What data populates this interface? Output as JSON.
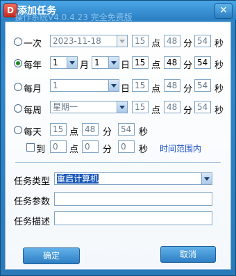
{
  "window": {
    "title": "添加任务",
    "watermark": "操作系统V4.0.4.23 完全免费版",
    "icon_letter": "D"
  },
  "units": {
    "hour": "点",
    "minute": "分",
    "second": "秒",
    "month": "月",
    "day": "日"
  },
  "once": {
    "label": "一次",
    "date": "2023-11-18",
    "hour": "15",
    "minute": "48",
    "second": "54"
  },
  "yearly": {
    "label": "每年",
    "month": "1",
    "day": "1",
    "hour": "15",
    "minute": "48",
    "second": "54"
  },
  "monthly": {
    "label": "每月",
    "day": "1",
    "hour": "15",
    "minute": "48",
    "second": "54"
  },
  "weekly": {
    "label": "每周",
    "weekday": "星期一",
    "hour": "15",
    "minute": "48",
    "second": "54"
  },
  "daily": {
    "label": "每天",
    "hour": "15",
    "minute": "48",
    "second": "54",
    "to_label": "到",
    "to_hour": "0",
    "to_minute": "0",
    "to_second": "0",
    "range_link": "时间范围内"
  },
  "task": {
    "type_label": "任务类型",
    "type_value": "重启计算机",
    "param_label": "任务参数",
    "param_value": "",
    "desc_label": "任务描述",
    "desc_value": ""
  },
  "buttons": {
    "ok": "确定",
    "cancel": "取消"
  },
  "colors": {
    "accent": "#2a7fc1",
    "selected_radio": "#1a8a1a",
    "link": "#1a4fc7"
  }
}
